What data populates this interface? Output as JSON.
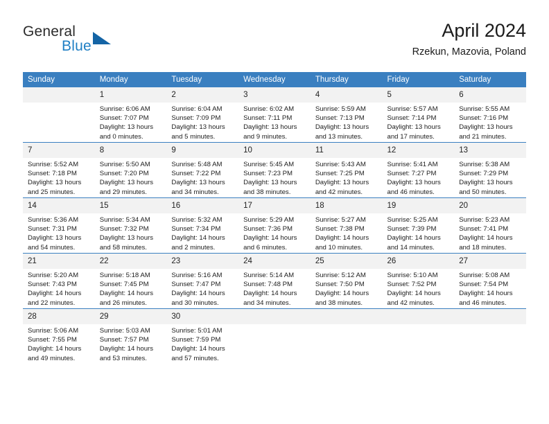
{
  "brand": {
    "name_primary": "General",
    "name_secondary": "Blue",
    "triangle_icon": "triangle-icon",
    "primary_color": "#2b2b2b",
    "secondary_color": "#1f7fc4",
    "triangle_color": "#1464a5"
  },
  "header": {
    "month_title": "April 2024",
    "location": "Rzekun, Mazovia, Poland"
  },
  "calendar": {
    "header_bg": "#3a7fc0",
    "daynum_bg": "#f2f2f2",
    "weekdays": [
      "Sunday",
      "Monday",
      "Tuesday",
      "Wednesday",
      "Thursday",
      "Friday",
      "Saturday"
    ],
    "weeks": [
      [
        {
          "day": "",
          "sunrise": "",
          "sunset": "",
          "daylight1": "",
          "daylight2": "",
          "empty": true
        },
        {
          "day": "1",
          "sunrise": "Sunrise: 6:06 AM",
          "sunset": "Sunset: 7:07 PM",
          "daylight1": "Daylight: 13 hours",
          "daylight2": "and 0 minutes."
        },
        {
          "day": "2",
          "sunrise": "Sunrise: 6:04 AM",
          "sunset": "Sunset: 7:09 PM",
          "daylight1": "Daylight: 13 hours",
          "daylight2": "and 5 minutes."
        },
        {
          "day": "3",
          "sunrise": "Sunrise: 6:02 AM",
          "sunset": "Sunset: 7:11 PM",
          "daylight1": "Daylight: 13 hours",
          "daylight2": "and 9 minutes."
        },
        {
          "day": "4",
          "sunrise": "Sunrise: 5:59 AM",
          "sunset": "Sunset: 7:13 PM",
          "daylight1": "Daylight: 13 hours",
          "daylight2": "and 13 minutes."
        },
        {
          "day": "5",
          "sunrise": "Sunrise: 5:57 AM",
          "sunset": "Sunset: 7:14 PM",
          "daylight1": "Daylight: 13 hours",
          "daylight2": "and 17 minutes."
        },
        {
          "day": "6",
          "sunrise": "Sunrise: 5:55 AM",
          "sunset": "Sunset: 7:16 PM",
          "daylight1": "Daylight: 13 hours",
          "daylight2": "and 21 minutes."
        }
      ],
      [
        {
          "day": "7",
          "sunrise": "Sunrise: 5:52 AM",
          "sunset": "Sunset: 7:18 PM",
          "daylight1": "Daylight: 13 hours",
          "daylight2": "and 25 minutes."
        },
        {
          "day": "8",
          "sunrise": "Sunrise: 5:50 AM",
          "sunset": "Sunset: 7:20 PM",
          "daylight1": "Daylight: 13 hours",
          "daylight2": "and 29 minutes."
        },
        {
          "day": "9",
          "sunrise": "Sunrise: 5:48 AM",
          "sunset": "Sunset: 7:22 PM",
          "daylight1": "Daylight: 13 hours",
          "daylight2": "and 34 minutes."
        },
        {
          "day": "10",
          "sunrise": "Sunrise: 5:45 AM",
          "sunset": "Sunset: 7:23 PM",
          "daylight1": "Daylight: 13 hours",
          "daylight2": "and 38 minutes."
        },
        {
          "day": "11",
          "sunrise": "Sunrise: 5:43 AM",
          "sunset": "Sunset: 7:25 PM",
          "daylight1": "Daylight: 13 hours",
          "daylight2": "and 42 minutes."
        },
        {
          "day": "12",
          "sunrise": "Sunrise: 5:41 AM",
          "sunset": "Sunset: 7:27 PM",
          "daylight1": "Daylight: 13 hours",
          "daylight2": "and 46 minutes."
        },
        {
          "day": "13",
          "sunrise": "Sunrise: 5:38 AM",
          "sunset": "Sunset: 7:29 PM",
          "daylight1": "Daylight: 13 hours",
          "daylight2": "and 50 minutes."
        }
      ],
      [
        {
          "day": "14",
          "sunrise": "Sunrise: 5:36 AM",
          "sunset": "Sunset: 7:31 PM",
          "daylight1": "Daylight: 13 hours",
          "daylight2": "and 54 minutes."
        },
        {
          "day": "15",
          "sunrise": "Sunrise: 5:34 AM",
          "sunset": "Sunset: 7:32 PM",
          "daylight1": "Daylight: 13 hours",
          "daylight2": "and 58 minutes."
        },
        {
          "day": "16",
          "sunrise": "Sunrise: 5:32 AM",
          "sunset": "Sunset: 7:34 PM",
          "daylight1": "Daylight: 14 hours",
          "daylight2": "and 2 minutes."
        },
        {
          "day": "17",
          "sunrise": "Sunrise: 5:29 AM",
          "sunset": "Sunset: 7:36 PM",
          "daylight1": "Daylight: 14 hours",
          "daylight2": "and 6 minutes."
        },
        {
          "day": "18",
          "sunrise": "Sunrise: 5:27 AM",
          "sunset": "Sunset: 7:38 PM",
          "daylight1": "Daylight: 14 hours",
          "daylight2": "and 10 minutes."
        },
        {
          "day": "19",
          "sunrise": "Sunrise: 5:25 AM",
          "sunset": "Sunset: 7:39 PM",
          "daylight1": "Daylight: 14 hours",
          "daylight2": "and 14 minutes."
        },
        {
          "day": "20",
          "sunrise": "Sunrise: 5:23 AM",
          "sunset": "Sunset: 7:41 PM",
          "daylight1": "Daylight: 14 hours",
          "daylight2": "and 18 minutes."
        }
      ],
      [
        {
          "day": "21",
          "sunrise": "Sunrise: 5:20 AM",
          "sunset": "Sunset: 7:43 PM",
          "daylight1": "Daylight: 14 hours",
          "daylight2": "and 22 minutes."
        },
        {
          "day": "22",
          "sunrise": "Sunrise: 5:18 AM",
          "sunset": "Sunset: 7:45 PM",
          "daylight1": "Daylight: 14 hours",
          "daylight2": "and 26 minutes."
        },
        {
          "day": "23",
          "sunrise": "Sunrise: 5:16 AM",
          "sunset": "Sunset: 7:47 PM",
          "daylight1": "Daylight: 14 hours",
          "daylight2": "and 30 minutes."
        },
        {
          "day": "24",
          "sunrise": "Sunrise: 5:14 AM",
          "sunset": "Sunset: 7:48 PM",
          "daylight1": "Daylight: 14 hours",
          "daylight2": "and 34 minutes."
        },
        {
          "day": "25",
          "sunrise": "Sunrise: 5:12 AM",
          "sunset": "Sunset: 7:50 PM",
          "daylight1": "Daylight: 14 hours",
          "daylight2": "and 38 minutes."
        },
        {
          "day": "26",
          "sunrise": "Sunrise: 5:10 AM",
          "sunset": "Sunset: 7:52 PM",
          "daylight1": "Daylight: 14 hours",
          "daylight2": "and 42 minutes."
        },
        {
          "day": "27",
          "sunrise": "Sunrise: 5:08 AM",
          "sunset": "Sunset: 7:54 PM",
          "daylight1": "Daylight: 14 hours",
          "daylight2": "and 46 minutes."
        }
      ],
      [
        {
          "day": "28",
          "sunrise": "Sunrise: 5:06 AM",
          "sunset": "Sunset: 7:55 PM",
          "daylight1": "Daylight: 14 hours",
          "daylight2": "and 49 minutes."
        },
        {
          "day": "29",
          "sunrise": "Sunrise: 5:03 AM",
          "sunset": "Sunset: 7:57 PM",
          "daylight1": "Daylight: 14 hours",
          "daylight2": "and 53 minutes."
        },
        {
          "day": "30",
          "sunrise": "Sunrise: 5:01 AM",
          "sunset": "Sunset: 7:59 PM",
          "daylight1": "Daylight: 14 hours",
          "daylight2": "and 57 minutes."
        },
        {
          "day": "",
          "sunrise": "",
          "sunset": "",
          "daylight1": "",
          "daylight2": "",
          "empty": true
        },
        {
          "day": "",
          "sunrise": "",
          "sunset": "",
          "daylight1": "",
          "daylight2": "",
          "empty": true
        },
        {
          "day": "",
          "sunrise": "",
          "sunset": "",
          "daylight1": "",
          "daylight2": "",
          "empty": true
        },
        {
          "day": "",
          "sunrise": "",
          "sunset": "",
          "daylight1": "",
          "daylight2": "",
          "empty": true
        }
      ]
    ]
  }
}
